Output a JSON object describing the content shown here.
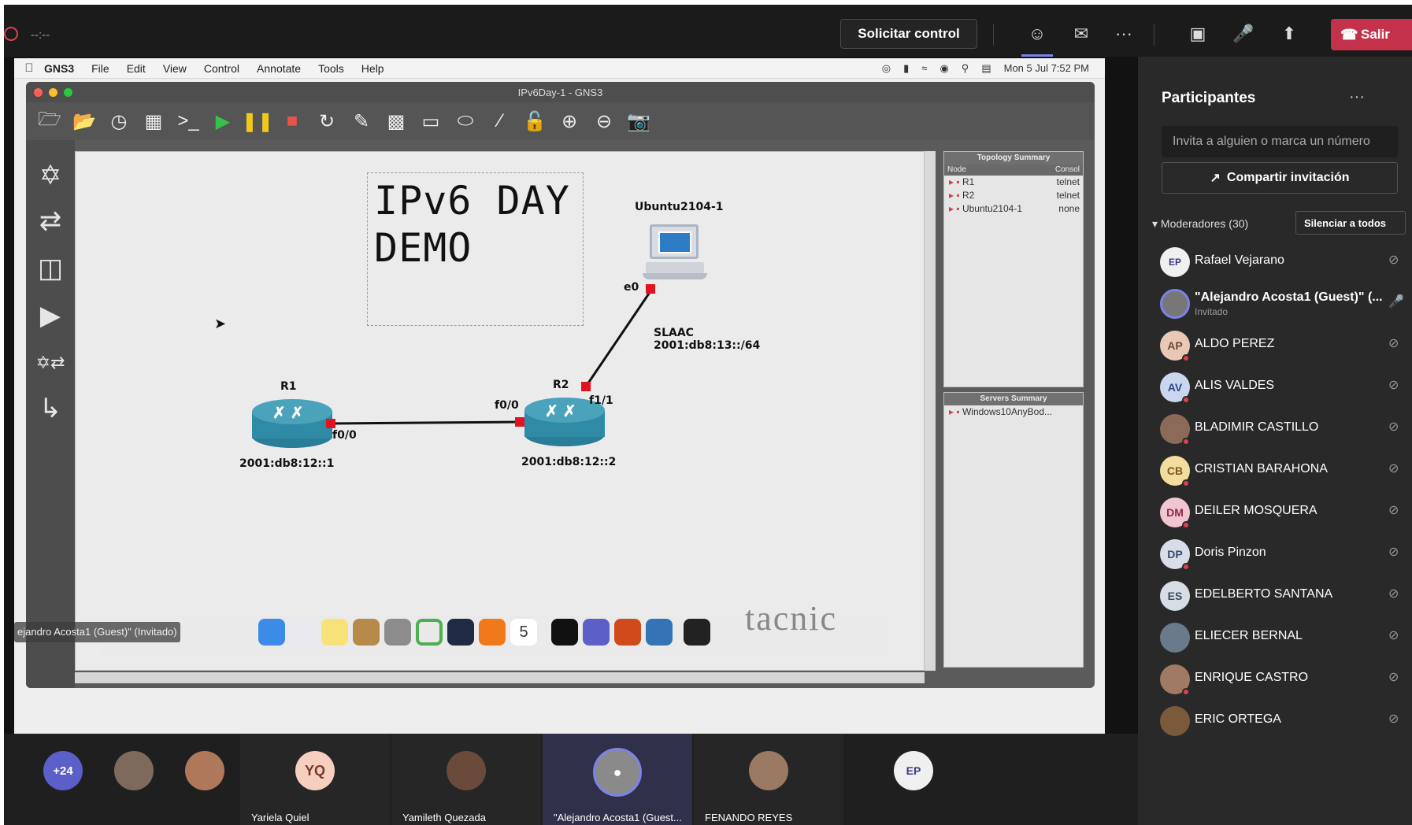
{
  "topbar": {
    "timer": "--:--",
    "request_control": "Solicitar control",
    "more": "···",
    "leave": "Salir"
  },
  "mac": {
    "menu": [
      "GNS3",
      "File",
      "Edit",
      "View",
      "Control",
      "Annotate",
      "Tools",
      "Help"
    ],
    "clock": "Mon 5 Jul  7:52 PM"
  },
  "gns3": {
    "window_title": "IPv6Day-1 - GNS3",
    "note_line1": "IPv6 DAY",
    "note_line2": "DEMO",
    "nodes": {
      "r1": {
        "name": "R1",
        "port": "f0/0",
        "address": "2001:db8:12::1"
      },
      "r2": {
        "name": "R2",
        "port_left": "f0/0",
        "port_right": "f1/1",
        "address": "2001:db8:12::2"
      },
      "ubuntu": {
        "name": "Ubuntu2104-1",
        "port": "e0",
        "slaac_label": "SLAAC",
        "slaac_prefix": "2001:db8:13::/64"
      }
    },
    "topology_summary": {
      "title": "Topology Summary",
      "col_node": "Node",
      "col_console": "Consol",
      "rows": [
        {
          "node": "R1",
          "console": "telnet"
        },
        {
          "node": "R2",
          "console": "telnet"
        },
        {
          "node": "Ubuntu2104-1",
          "console": "none"
        }
      ]
    },
    "servers_summary": {
      "title": "Servers Summary",
      "rows": [
        {
          "name": "Windows10AnyBod..."
        }
      ]
    }
  },
  "dock": {
    "calendar_day": "5",
    "bg_word": "tacnic"
  },
  "share_badge": "ejandro Acosta1 (Guest)\" (Invitado)",
  "participants": {
    "title": "Participantes",
    "more": "···",
    "invite_placeholder": "Invita a alguien o marca un número",
    "share_invite": "Compartir invitación",
    "moderators_label": "Moderadores (30)",
    "mute_all": "Silenciar a todos",
    "people": [
      {
        "initials": "",
        "name": "Rafael Vejarano",
        "sub": ""
      },
      {
        "initials": "",
        "name": "\"Alejandro Acosta1 (Guest)\" (...",
        "sub": "Invitado"
      },
      {
        "initials": "AP",
        "name": "ALDO PEREZ",
        "sub": ""
      },
      {
        "initials": "AV",
        "name": "ALIS VALDES",
        "sub": ""
      },
      {
        "initials": "",
        "name": "BLADIMIR CASTILLO",
        "sub": ""
      },
      {
        "initials": "CB",
        "name": "CRISTIAN BARAHONA",
        "sub": ""
      },
      {
        "initials": "DM",
        "name": "DEILER MOSQUERA",
        "sub": ""
      },
      {
        "initials": "DP",
        "name": "Doris Pinzon",
        "sub": ""
      },
      {
        "initials": "ES",
        "name": "EDELBERTO SANTANA",
        "sub": ""
      },
      {
        "initials": "",
        "name": "ELIECER BERNAL",
        "sub": ""
      },
      {
        "initials": "",
        "name": "ENRIQUE CASTRO",
        "sub": ""
      },
      {
        "initials": "",
        "name": "ERIC ORTEGA",
        "sub": ""
      }
    ]
  },
  "gallery": {
    "overflow": "+24",
    "tiles": [
      {
        "initials": "YQ",
        "name": "Yariela Quiel"
      },
      {
        "initials": "",
        "name": "Yamileth Quezada"
      },
      {
        "initials": "",
        "name": "\"Alejandro Acosta1 (Guest..."
      },
      {
        "initials": "",
        "name": "FENANDO REYES"
      }
    ]
  },
  "colors": {
    "accent": "#7b83eb",
    "leave": "#c4314b",
    "port": "#e2131e",
    "router": "#2f8aa5"
  }
}
